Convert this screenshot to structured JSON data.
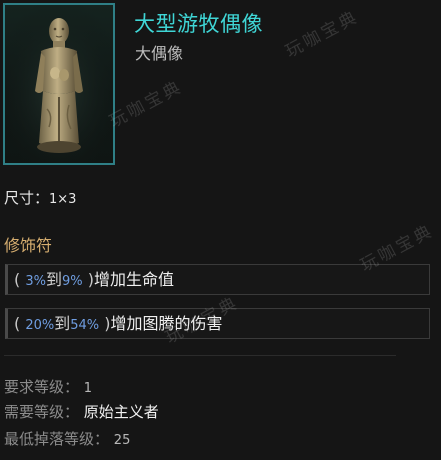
{
  "item": {
    "name": "大型游牧偶像",
    "base_type": "大偶像",
    "icon": "idol-statue-icon"
  },
  "size": {
    "label": "尺寸：",
    "value": "1×3"
  },
  "modifiers": {
    "title": "修饰符",
    "lines": [
      {
        "open": "(",
        "min": "3%",
        "to": "到",
        "max": "9%",
        "close": ")",
        "text": "增加生命值"
      },
      {
        "open": "(",
        "min": "20%",
        "to": "到",
        "max": "54%",
        "close": ")",
        "text": "增加图腾的伤害"
      }
    ]
  },
  "requirements": {
    "level_label": "要求等级：",
    "level_value": "1",
    "class_label": "需要等级：",
    "class_value": "原始主义者",
    "drop_label": "最低掉落等级：",
    "drop_value": "25"
  },
  "watermark": "玩咖宝典",
  "colors": {
    "name": "#3fd6d6",
    "section_title": "#d5ad6f",
    "range_number": "#6f9de0",
    "frame": "#2f7f86"
  }
}
